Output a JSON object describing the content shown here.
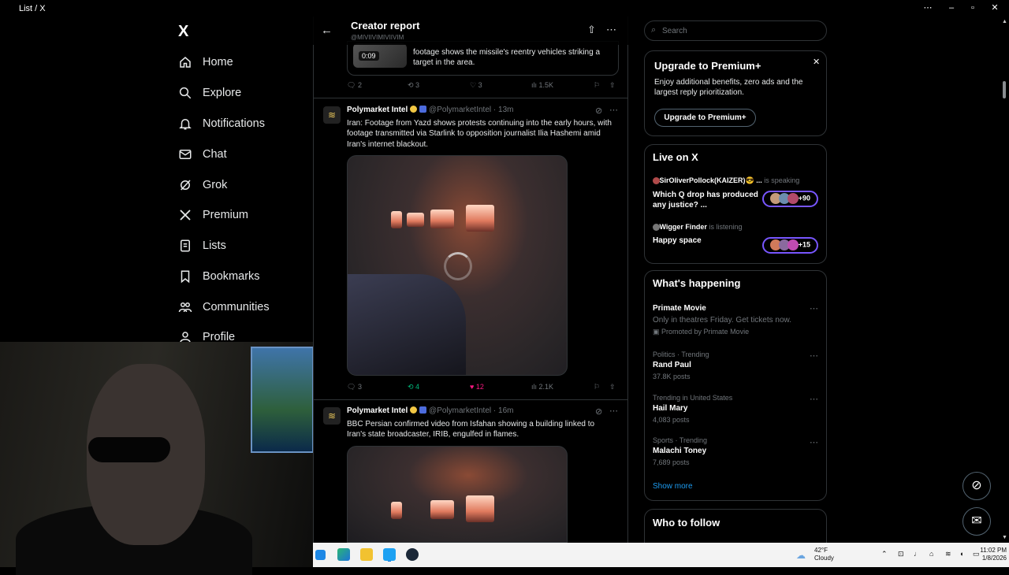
{
  "window": {
    "title": "List / X"
  },
  "nav": {
    "logo": "X",
    "items": [
      "Home",
      "Explore",
      "Notifications",
      "Chat",
      "Grok",
      "Premium",
      "Lists",
      "Bookmarks",
      "Communities",
      "Profile"
    ]
  },
  "header": {
    "title": "Creator report",
    "subtitle": "@MIVIIVIMIVIIVIM"
  },
  "prev_tweet": {
    "video_time": "0:09",
    "text": "footage shows the missile's reentry vehicles striking a target in the area.",
    "replies": "2",
    "reposts": "3",
    "likes": "3",
    "views": "1.5K"
  },
  "tweet1": {
    "name": "Polymarket Intel",
    "handle": "@PolymarketIntel · 13m",
    "text": "Iran: Footage from Yazd shows protests continuing into the early hours, with footage transmitted via Starlink to opposition journalist Ilia Hashemi amid Iran's internet blackout.",
    "replies": "3",
    "reposts": "4",
    "likes": "12",
    "views": "2.1K"
  },
  "tweet2": {
    "name": "Polymarket Intel",
    "handle": "@PolymarketIntel · 16m",
    "text": "BBC Persian confirmed video from Isfahan showing a building linked to Iran's state broadcaster, IRIB, engulfed in flames."
  },
  "search": {
    "placeholder": "Search"
  },
  "premium": {
    "title": "Upgrade to Premium+",
    "body": "Enjoy additional benefits, zero ads and the largest reply prioritization.",
    "button": "Upgrade to Premium+"
  },
  "live": {
    "title": "Live on X",
    "items": [
      {
        "host": "SirOliverPollock(KAIZER)😎 ...",
        "status": "is speaking",
        "topic": "Which Q drop has produced any justice? ...",
        "count": "+90"
      },
      {
        "host": "Wigger Finder",
        "status": "is listening",
        "topic": "Happy space",
        "count": "+15"
      }
    ]
  },
  "happening": {
    "title": "What's happening",
    "items": [
      {
        "meta": "",
        "name": "Primate Movie",
        "desc": "Only in theatres Friday. Get tickets now.",
        "promo": "Promoted by Primate Movie"
      },
      {
        "meta": "Politics · Trending",
        "name": "Rand Paul",
        "posts": "37.8K posts"
      },
      {
        "meta": "Trending in United States",
        "name": "Hail Mary",
        "posts": "4,083 posts"
      },
      {
        "meta": "Sports · Trending",
        "name": "Malachi Toney",
        "posts": "7,689 posts"
      }
    ],
    "show_more": "Show more"
  },
  "follow": {
    "title": "Who to follow"
  },
  "taskbar": {
    "temp": "42°F",
    "weather": "Cloudy",
    "time": "11:02 PM",
    "date": "1/8/2026"
  }
}
